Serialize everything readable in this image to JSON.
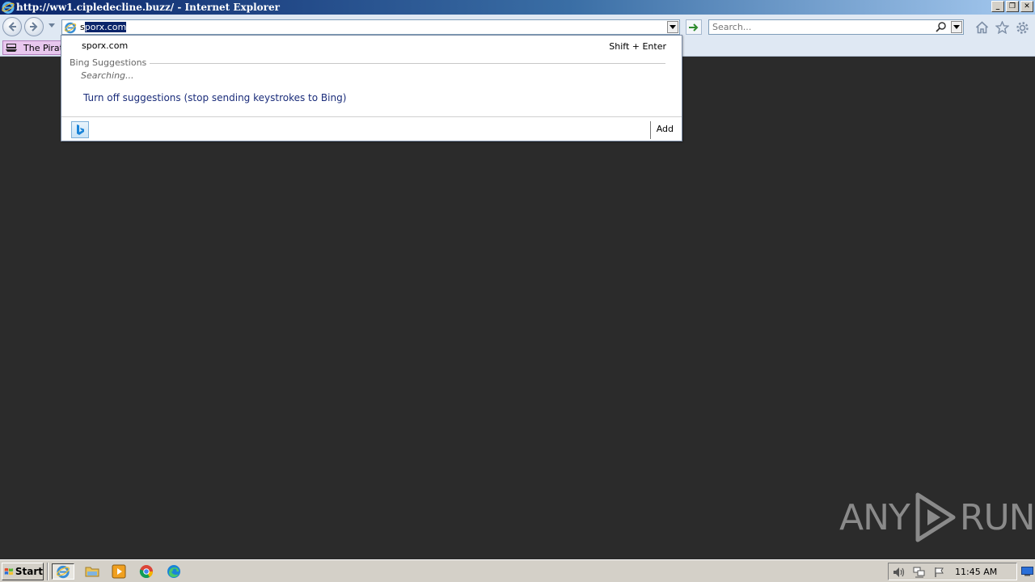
{
  "window": {
    "title": "http://ww1.cipledecline.buzz/ - Internet Explorer",
    "controls": {
      "minimize": "_",
      "restore": "❐",
      "close": "✕"
    }
  },
  "address": {
    "typed_prefix": "s",
    "selected_suffix": "porx.com"
  },
  "search": {
    "placeholder": "Search..."
  },
  "favorites": {
    "items": [
      {
        "label": "The Pirate"
      }
    ]
  },
  "dropdown": {
    "suggestion": "sporx.com",
    "shortcut": "Shift + Enter",
    "section_label": "Bing Suggestions",
    "searching": "Searching...",
    "turn_off": "Turn off suggestions (stop sending keystrokes to Bing)",
    "add_label": "Add"
  },
  "watermark": {
    "left": "ANY",
    "right": "RUN"
  },
  "taskbar": {
    "start_label": "Start",
    "clock": "11:45 AM"
  },
  "colors": {
    "titlebar_start": "#0a246a",
    "desktop_bg": "#2b2b2b",
    "link": "#1a2c7a",
    "go_arrow": "#2e8b2e"
  }
}
